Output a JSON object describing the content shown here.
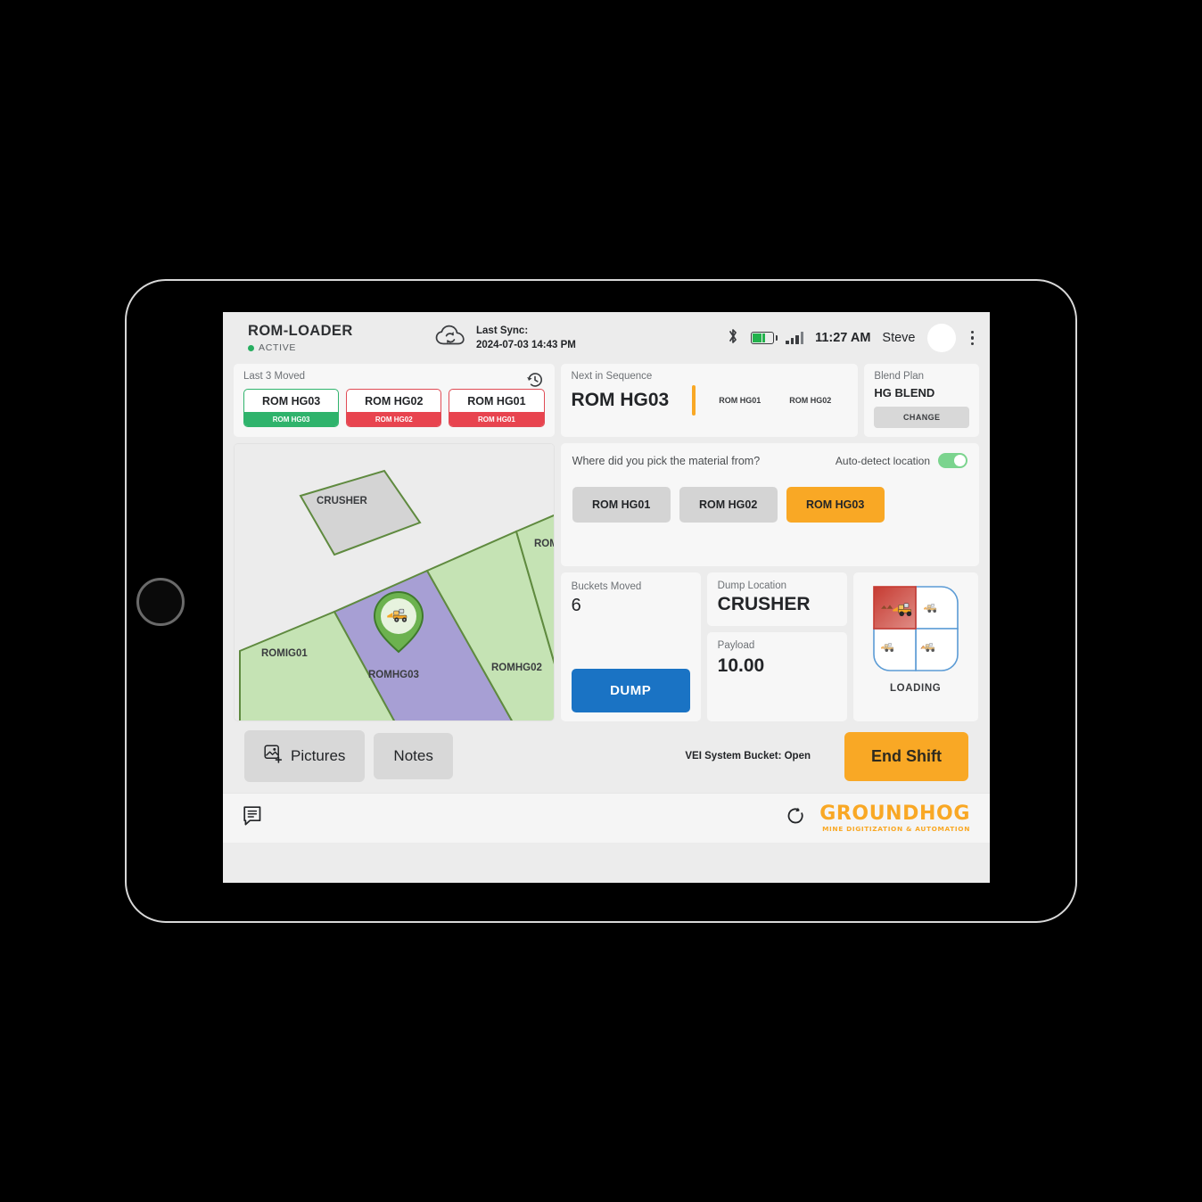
{
  "header": {
    "app_title": "ROM-LOADER",
    "status": "ACTIVE",
    "sync_label": "Last Sync:",
    "sync_time": "2024-07-03 14:43 PM",
    "clock": "11:27 AM",
    "user": "Steve",
    "icons": {
      "sync": "cloud-sync-icon",
      "bluetooth": "bluetooth-icon",
      "battery": "battery-icon",
      "signal": "signal-icon",
      "kebab": "more-options-icon"
    }
  },
  "last_moved": {
    "title": "Last 3 Moved",
    "history_icon": "history-icon",
    "chips": [
      {
        "name": "ROM HG03",
        "sub": "ROM HG03",
        "color": "#2fb36c",
        "state": "green"
      },
      {
        "name": "ROM HG02",
        "sub": "ROM HG02",
        "color": "#e8444f",
        "state": "red"
      },
      {
        "name": "ROM HG01",
        "sub": "ROM HG01",
        "color": "#e8444f",
        "state": "red"
      }
    ]
  },
  "next_sequence": {
    "title": "Next in Sequence",
    "current": "ROM HG03",
    "upcoming": [
      "ROM HG01",
      "ROM HG02"
    ],
    "accent": "#f9a825"
  },
  "blend_plan": {
    "title": "Blend Plan",
    "value": "HG BLEND",
    "change_label": "CHANGE"
  },
  "map": {
    "zones": [
      {
        "label": "CRUSHER",
        "fill": "#d4d4d4",
        "stroke": "#5f8a3f"
      },
      {
        "label": "ROMIG01",
        "fill": "#c5e3b4",
        "stroke": "#5f8a3f"
      },
      {
        "label": "ROMHG03",
        "fill": "#a79fd4",
        "stroke": "#5f8a3f"
      },
      {
        "label": "ROMHG02",
        "fill": "#c5e3b4",
        "stroke": "#5f8a3f"
      },
      {
        "label": "ROM",
        "fill": "#c5e3b4",
        "stroke": "#5f8a3f"
      }
    ],
    "marker": "loader-position-marker"
  },
  "pick": {
    "question": "Where did you pick the material from?",
    "auto_detect_label": "Auto-detect location",
    "auto_detect_on": true,
    "options": [
      "ROM HG01",
      "ROM HG02",
      "ROM HG03"
    ],
    "selected": "ROM HG03",
    "selected_color": "#f9a825"
  },
  "buckets": {
    "label": "Buckets Moved",
    "value": "6",
    "dump_label": "DUMP",
    "dump_color": "#1a73c4"
  },
  "dump_location": {
    "label": "Dump Location",
    "value": "CRUSHER"
  },
  "payload": {
    "label": "Payload",
    "value": "10.00"
  },
  "machine_state": {
    "label": "LOADING",
    "active_quadrant": "top-left",
    "active_color": "#c63b32",
    "quadrants": [
      "loading",
      "hauling",
      "travelling-empty",
      "dumping"
    ]
  },
  "actions": {
    "pictures": "Pictures",
    "notes": "Notes",
    "vei_status": "VEI System Bucket: Open",
    "end_shift": "End Shift",
    "end_shift_color": "#f9a825"
  },
  "footer": {
    "chat_icon": "chat-icon",
    "refresh_icon": "refresh-icon",
    "logo_name": "GROUNDHOG",
    "logo_tagline": "MINE DIGITIZATION & AUTOMATION",
    "logo_color": "#f9a825"
  }
}
